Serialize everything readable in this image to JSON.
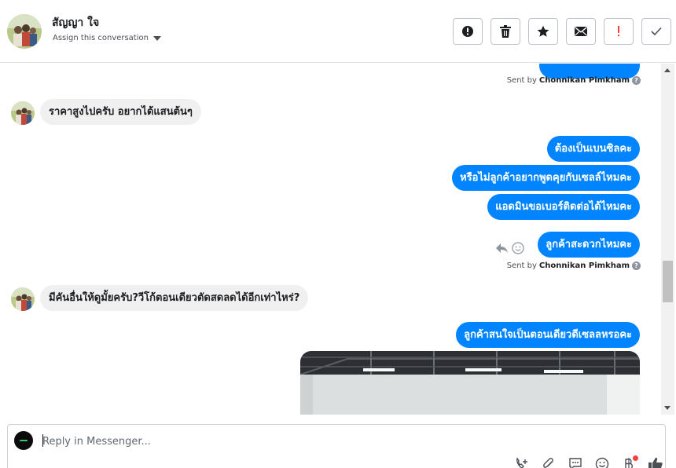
{
  "header": {
    "contact_name": "สัญญา ใจ",
    "assign_label": "Assign this conversation",
    "actions": [
      {
        "name": "report-spam-button",
        "icon": "exclamation-circle-icon"
      },
      {
        "name": "delete-button",
        "icon": "trash-icon"
      },
      {
        "name": "star-button",
        "icon": "star-icon"
      },
      {
        "name": "mark-unread-button",
        "icon": "envelope-icon"
      },
      {
        "name": "follow-up-button",
        "icon": "red-exclamation-icon"
      },
      {
        "name": "mark-done-button",
        "icon": "checkmark-icon"
      }
    ]
  },
  "thread": {
    "sent_by_prefix": "Sent by",
    "sender_name": "Chonnikan Pimkham",
    "messages": [
      {
        "dir": "in",
        "text": "ราคาสูงไปครับ อยากได้แสนต้นๆ"
      },
      {
        "dir": "out",
        "text": "ต้องเป็นเบนซิลคะ"
      },
      {
        "dir": "out",
        "text": "หรือไม่ลูกค้าอยากพูดคุยกับเซลล์ไหมคะ"
      },
      {
        "dir": "out",
        "text": "แอดมินขอเบอร์ติดต่อได้ไหมคะ"
      },
      {
        "dir": "out",
        "text": "ลูกค้าสะดวกไหมคะ"
      },
      {
        "dir": "in",
        "text": "มีคันอื่นให้ดูมั้ยครับ?วีโก้ตอนเดียวตัดสดลดได้อีกเท่าไหร่?"
      },
      {
        "dir": "out",
        "text": "ลูกค้าสนใจเป็นตอนเดียวดีเซลลหรอคะ"
      }
    ]
  },
  "composer": {
    "placeholder": "Reply in Messenger...",
    "tools": [
      "add-contact-icon",
      "attachment-icon",
      "saved-replies-icon",
      "emoji-icon",
      "baht-payment-icon",
      "like-icon"
    ]
  },
  "colors": {
    "outgoing_bubble": "#0084ff",
    "incoming_bubble": "#f1f0f0",
    "alert_red": "#fa3e3e"
  }
}
